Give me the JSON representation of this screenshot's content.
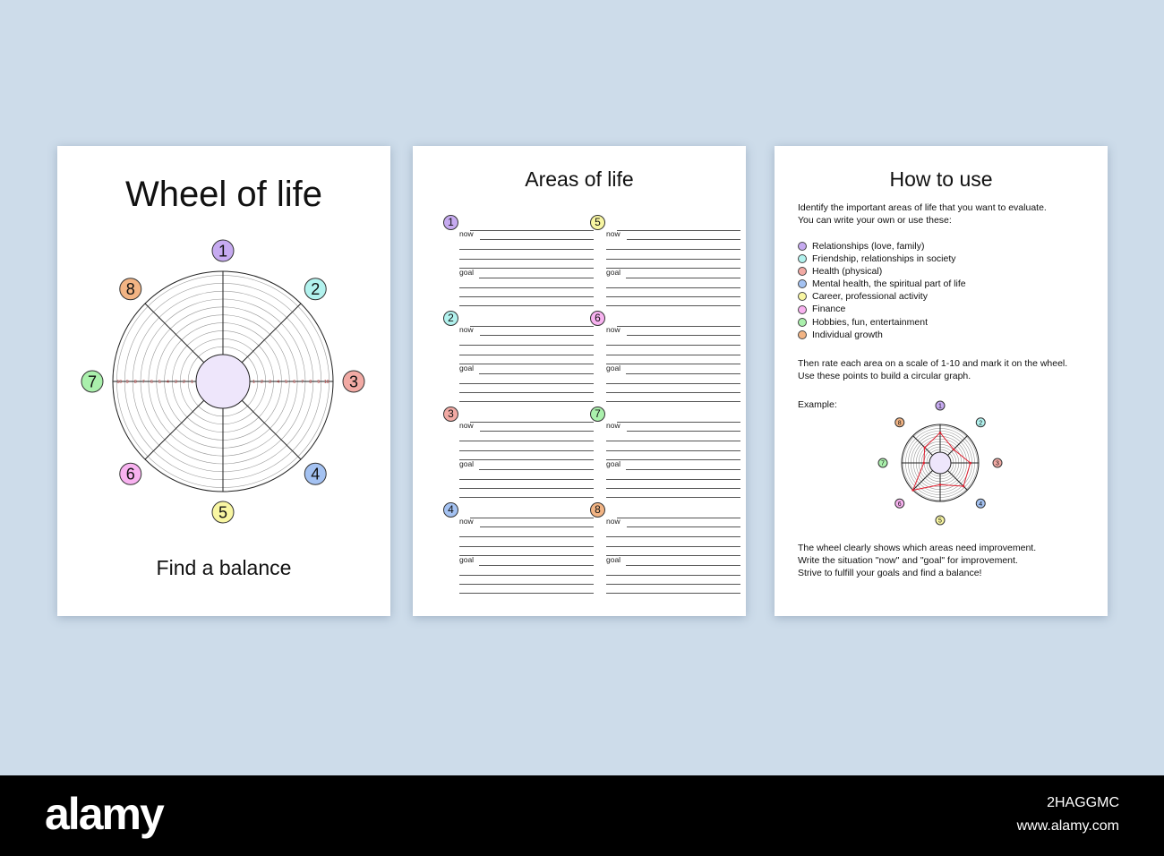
{
  "page1": {
    "title": "Wheel of life",
    "subtitle": "Find a balance",
    "scale": [
      "1",
      "2",
      "3",
      "4",
      "5",
      "6",
      "7",
      "8",
      "9",
      "10"
    ]
  },
  "areas": [
    {
      "num": "1",
      "color": "#c6aaf0"
    },
    {
      "num": "2",
      "color": "#b2f2ee"
    },
    {
      "num": "3",
      "color": "#f2aaa4"
    },
    {
      "num": "4",
      "color": "#a4c2f2"
    },
    {
      "num": "5",
      "color": "#f8f6a2"
    },
    {
      "num": "6",
      "color": "#f8b2f0"
    },
    {
      "num": "7",
      "color": "#aaf0ac"
    },
    {
      "num": "8",
      "color": "#f2b484"
    }
  ],
  "page2": {
    "title": "Areas of life",
    "now_label": "now",
    "goal_label": "goal"
  },
  "page3": {
    "title": "How to use",
    "intro": [
      "Identify the important areas of life that you want  to evaluate.",
      "You can write your own or use these:"
    ],
    "legend": [
      "Relationships (love, family)",
      "Friendship, relationships in society",
      "Health (physical)",
      "Mental health, the spiritual part of life",
      "Career, professional activity",
      "Finance",
      "Hobbies, fun, entertainment",
      "Individual growth"
    ],
    "rate": [
      "Then rate each area on a scale of 1-10 and mark it on the wheel.",
      "Use these points to build a circular graph."
    ],
    "example_label": "Example:",
    "example_values": [
      7,
      3,
      7,
      8,
      4,
      10,
      2,
      4
    ],
    "outro": [
      "The wheel clearly shows which areas need improvement.",
      "Write the situation \"now\" and \"goal\" for improvement.",
      "Strive to fulfill your goals and find a balance!"
    ]
  },
  "footer": {
    "logo": "alamy",
    "image_id": "2HAGGMC",
    "site": "www.alamy.com"
  }
}
